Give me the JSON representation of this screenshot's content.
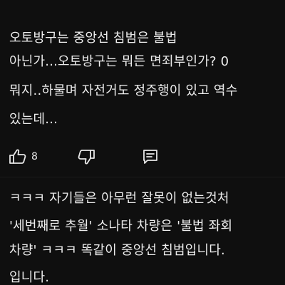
{
  "comments": [
    {
      "lines": [
        "오토방구는 중앙선 침범은 불법",
        "아닌가...오토방구는 뭐든 면죄부인가? 0",
        "뭐지..하물며 자전거도 정주행이 있고 역수",
        "있는데..."
      ],
      "actions": {
        "like_icon": "thumbs-up-icon",
        "like_count": "8",
        "dislike_icon": "thumbs-down-icon",
        "reply_icon": "reply-comment-icon"
      }
    },
    {
      "lines": [
        "ㅋㅋㅋ 자기들은 아무런 잘못이 없는것처",
        "'세번째로 추월' 소나타 차량은 '불법 좌회",
        "차량' ㅋㅋㅋ 똑같이 중앙선 침범입니다.",
        "입니다."
      ]
    }
  ],
  "colors": {
    "background": "#0f0f0f",
    "text": "#ededed",
    "icon": "#e8e8e8"
  }
}
